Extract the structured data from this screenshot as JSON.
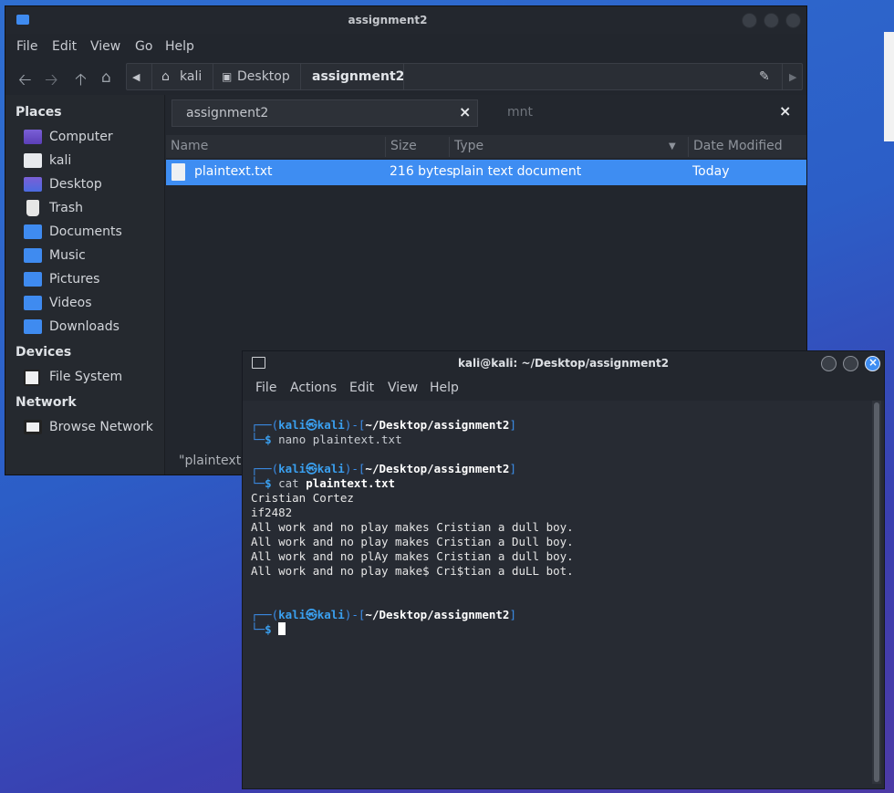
{
  "file_manager": {
    "title": "assignment2",
    "menu": [
      "File",
      "Edit",
      "View",
      "Go",
      "Help"
    ],
    "toolbar": {
      "back_icon": "arrow-left-icon",
      "forward_icon": "arrow-right-icon",
      "up_icon": "arrow-up-icon",
      "home_icon": "home-icon"
    },
    "breadcrumbs": [
      "kali",
      "Desktop",
      "assignment2"
    ],
    "sidebar": {
      "places_heading": "Places",
      "places": [
        "Computer",
        "kali",
        "Desktop",
        "Trash",
        "Documents",
        "Music",
        "Pictures",
        "Videos",
        "Downloads"
      ],
      "devices_heading": "Devices",
      "devices": [
        "File System"
      ],
      "network_heading": "Network",
      "network": [
        "Browse Network"
      ]
    },
    "tabs": [
      {
        "label": "assignment2",
        "close": "×"
      },
      {
        "label": "mnt",
        "close": "×"
      }
    ],
    "columns": [
      "Name",
      "Size",
      "Type",
      "Date Modified"
    ],
    "rows": [
      {
        "name": "plaintext.txt",
        "size": "216 bytes",
        "type": "plain text document",
        "modified": "Today"
      }
    ],
    "status": "\"plaintext.t"
  },
  "terminal": {
    "title": "kali@kali: ~/Desktop/assignment2",
    "menu": [
      "File",
      "Actions",
      "Edit",
      "View",
      "Help"
    ],
    "prompt": {
      "top_open": "┌──(",
      "user": "kali",
      "at": "㉿",
      "host": "kali",
      "mid": ")-[",
      "path": "~/Desktop/assignment2",
      "close": "]",
      "bottom": "└─",
      "dollar": "$"
    },
    "cmd1_word": "nano",
    "cmd1_arg": "plaintext.txt",
    "cmd2_word": "cat",
    "cmd2_arg": "plaintext.txt",
    "output": [
      "Cristian Cortez",
      "if2482",
      "All work and no play makes Cristian a dull boy.",
      "All work and no play makes Cristian a Dull boy.",
      "All work and no plAy makes Cristian a dull boy.",
      "All work and no play make$ Cri$tian a duLL bot."
    ]
  },
  "colors": {
    "accent": "#3e8df2",
    "prompt_blue": "#3b8eea",
    "terminal_bg": "#272b33",
    "window_bg": "#22262d"
  }
}
